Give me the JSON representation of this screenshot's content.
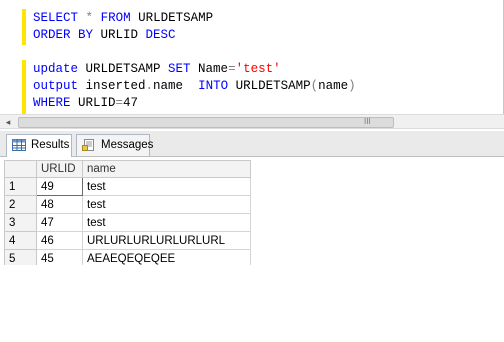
{
  "editor": {
    "lines": [
      [
        {
          "t": "SELECT",
          "c": "kw"
        },
        {
          "t": " ",
          "c": "id"
        },
        {
          "t": "*",
          "c": "op"
        },
        {
          "t": " ",
          "c": "id"
        },
        {
          "t": "FROM",
          "c": "kw"
        },
        {
          "t": " URLDETSAMP",
          "c": "id"
        }
      ],
      [
        {
          "t": "ORDER BY",
          "c": "kw"
        },
        {
          "t": " URLID ",
          "c": "id"
        },
        {
          "t": "DESC",
          "c": "kw"
        }
      ],
      [],
      [
        {
          "t": "update",
          "c": "kw"
        },
        {
          "t": " URLDETSAMP ",
          "c": "id"
        },
        {
          "t": "SET",
          "c": "kw"
        },
        {
          "t": " Name",
          "c": "id"
        },
        {
          "t": "=",
          "c": "op"
        },
        {
          "t": "'test'",
          "c": "str"
        }
      ],
      [
        {
          "t": "output",
          "c": "kw"
        },
        {
          "t": " inserted",
          "c": "id"
        },
        {
          "t": ".",
          "c": "op"
        },
        {
          "t": "name  ",
          "c": "id"
        },
        {
          "t": "INTO",
          "c": "kw"
        },
        {
          "t": " URLDETSAMP",
          "c": "id"
        },
        {
          "t": "(",
          "c": "op"
        },
        {
          "t": "name",
          "c": "id"
        },
        {
          "t": ")",
          "c": "op"
        }
      ],
      [
        {
          "t": "WHERE",
          "c": "kw"
        },
        {
          "t": " URLID",
          "c": "id"
        },
        {
          "t": "=",
          "c": "op"
        },
        {
          "t": "47",
          "c": "id"
        }
      ]
    ]
  },
  "scrollbar": {
    "left_arrow": "◂",
    "grip": "III"
  },
  "tabs": [
    {
      "label": "Results",
      "icon": "grid-icon",
      "active": true
    },
    {
      "label": "Messages",
      "icon": "messages-icon",
      "active": false
    }
  ],
  "results": {
    "columns": [
      "",
      "URLID",
      "name"
    ],
    "rows": [
      [
        "1",
        "49",
        "test"
      ],
      [
        "2",
        "48",
        "test"
      ],
      [
        "3",
        "47",
        "test"
      ],
      [
        "4",
        "46",
        "URLURLURLURLURLURL"
      ],
      [
        "5",
        "45",
        "AEAEQEQEQEE"
      ]
    ]
  }
}
